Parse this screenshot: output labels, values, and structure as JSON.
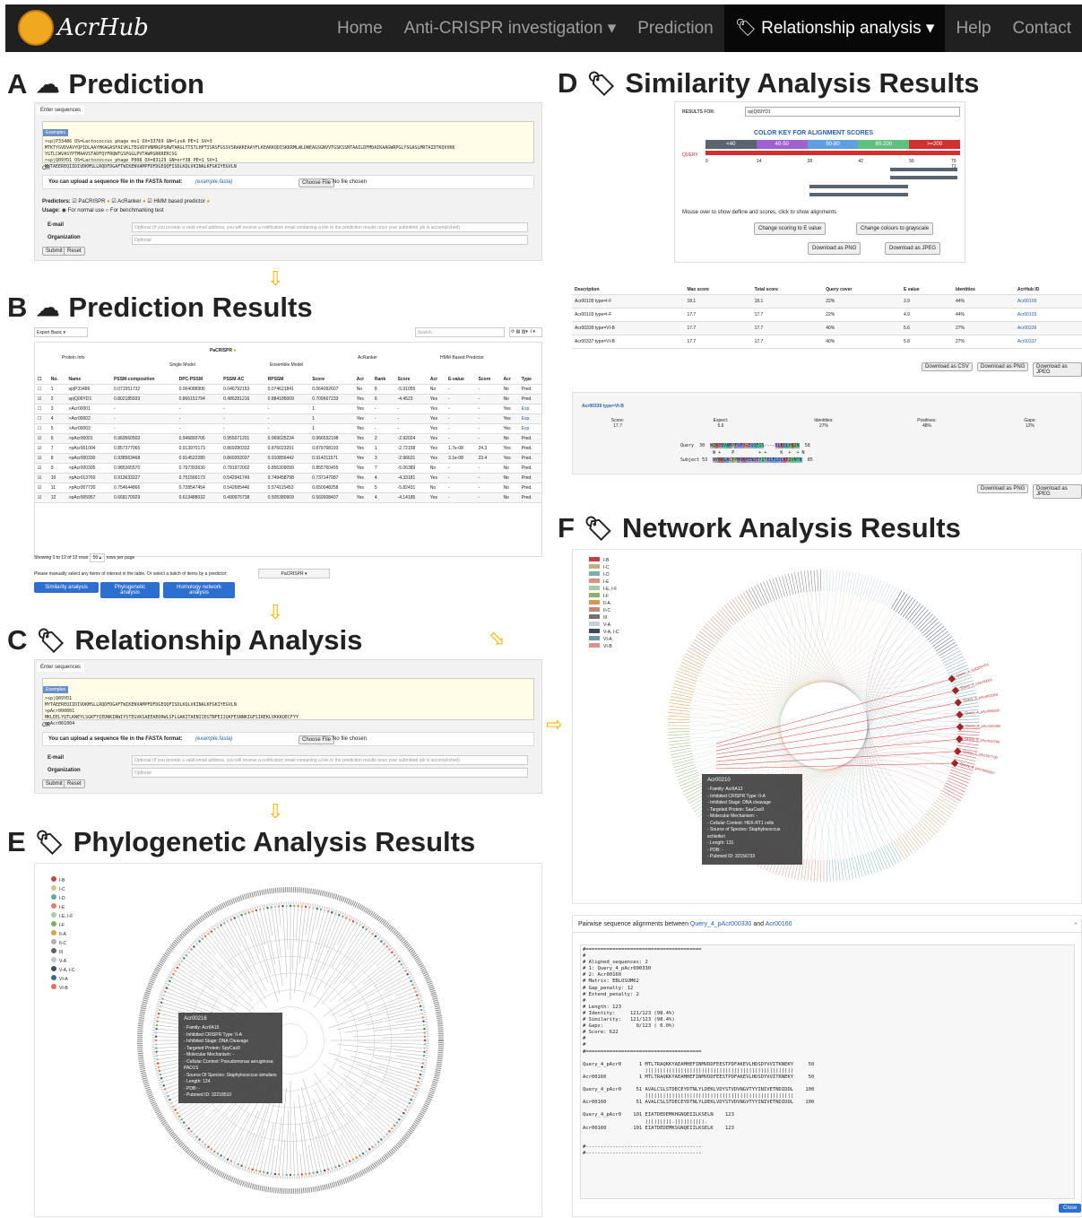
{
  "nav": {
    "logo": "AcrHub",
    "items": [
      "Home",
      "Anti-CRISPR investigation ▾",
      "Prediction",
      "🏷 Relationship analysis ▾",
      "Help",
      "Contact"
    ]
  },
  "sections": {
    "A": {
      "letter": "A",
      "icon": "☁",
      "title": "Prediction"
    },
    "B": {
      "letter": "B",
      "icon": "☁",
      "title": "Prediction Results"
    },
    "C": {
      "letter": "C",
      "icon": "🏷",
      "title": "Relationship Analysis"
    },
    "D": {
      "letter": "D",
      "icon": "🏷",
      "title": "Similarity Analysis Results"
    },
    "E": {
      "letter": "E",
      "icon": "🏷",
      "title": "Phylogenetic Analysis Results"
    },
    "F": {
      "letter": "F",
      "icon": "🏷",
      "title": "Network Analysis Results"
    }
  },
  "predform": {
    "tab": "Enter sequences",
    "example": "Examples",
    "seq": ">sp|P33486 OS=Lactococcus phage mv1 OX=33769 GN=lysA PE=1 SV=3\nMTKTYGVDVAVYQPIDLAAYHKAGASFAIVKLTEGVDYVNMRGPSRWTARGLTTSTLHPTISRSFGSSVSRAKKEAAYFLKEAKKQDISKKRMLWLDWEAGSGNVVTGSKSSNTAAILDFMDAIKAAGWRPGLYSGASLMRTAIDTKQVVKK\nYGTLCWVASYPTMAAVSTADFQYFRQWTGSPGGLPVTAWPGRRRERCSG\n>sp|Q09YD1 OS=Lactococcus phage P008 OX=83129 GN=orf38 PE=1 SV=1\nMYTAEEREQIIDIVDKMSLLRQDFDGAFTWIKENVAMPFDFDGEQQFISDLKQLVKINALKFGKIYEGVLN",
    "or": "OR",
    "upload": "You can upload a sequence file in the FASTA format:",
    "upload_link": "(example.fasta)",
    "choose": "Choose File",
    "nofile": "No file chosen",
    "predictors_label": "Predictors:",
    "predictors": [
      "PaCRISPR",
      "AcRanker",
      "HMM based predictor"
    ],
    "usage_label": "Usage:",
    "usage": [
      "For normal use",
      "For benchmarking test"
    ],
    "email_label": "E-mail",
    "email_ph": "Optional (If you provide a valid email address, you will receive a notification email containing a link to the prediction results once your submitted job is accomplished)",
    "org_label": "Organization",
    "org_ph": "Optional",
    "submit": "Submit",
    "reset": "Reset"
  },
  "results": {
    "export": "Export Basic",
    "search": "Search",
    "group_pacrispr": "PaCRISPR",
    "group_single": "Single Model",
    "group_ensemble": "Ensemble Model",
    "group_acranker": "AcRanker",
    "group_hmm": "HMM Based Predictor",
    "headers": [
      "No.",
      "Name",
      "PSSM-composition",
      "DPC-PSSM",
      "PSSM-AC",
      "RPSSM",
      "Score",
      "Acr",
      "Rank",
      "Score",
      "Acr",
      "E-value",
      "Score",
      "Acr",
      "Type"
    ],
    "protein_info": "Protein Info",
    "rows": [
      [
        "1",
        "sp|P33486",
        "0.071551732",
        "0.064088906",
        "0.046792153",
        "0.074621841",
        "0.064092607",
        "No",
        "8",
        "-5.91055",
        "No",
        "-",
        "-",
        "No",
        "Pred."
      ],
      [
        "2",
        "sp|Q09YD1",
        "0.802185933",
        "0.866151794",
        "0.486281216",
        "0.884185009",
        "0.709667233",
        "Yes",
        "6",
        "-4.4523",
        "Yes",
        "-",
        "-",
        "No",
        "Pred."
      ],
      [
        "3",
        "&gt;Acr00001",
        "-",
        "-",
        "-",
        "-",
        "1",
        "Yes",
        "-",
        "-",
        "Yes",
        "-",
        "-",
        "Yes",
        "Exp."
      ],
      [
        "4",
        "&gt;Acr00002",
        "-",
        "-",
        "-",
        "-",
        "1",
        "Yes",
        "-",
        "-",
        "Yes",
        "-",
        "-",
        "Yes",
        "Exp."
      ],
      [
        "5",
        "&gt;Acr00003",
        "-",
        "-",
        "-",
        "-",
        "1",
        "Yes",
        "-",
        "-",
        "Yes",
        "-",
        "-",
        "Yes",
        "Exp."
      ],
      [
        "6",
        "&gt;pAcr00001",
        "0.960560503",
        "0.946893706",
        "0.955071201",
        "0.969025234",
        "0.966532198",
        "Yes",
        "2",
        "-2.92024",
        "Yes",
        "-",
        "-",
        "No",
        "Pred."
      ],
      [
        "7",
        "&gt;pAcr001004",
        "0.857377065",
        "0.913970173",
        "0.869280332",
        "0.876023291",
        "0.879768193",
        "Yes",
        "1",
        "-2.72158",
        "Yes",
        "1.7e-08",
        "24.3",
        "Yes",
        "Pred."
      ],
      [
        "8",
        "&gt;pAcr000330",
        "0.938563468",
        "0.914522280",
        "0.869392037",
        "0.910856442",
        "0.914211571",
        "Yes",
        "3",
        "-2.96631",
        "Yes",
        "3.1e-08",
        "23.4",
        "Yes",
        "Pred."
      ],
      [
        "9",
        "&gt;pAcr000395",
        "0.985365570",
        "0.797393630",
        "0.781972002",
        "0.856309099",
        "0.855760455",
        "Yes",
        "7",
        "-5.06389",
        "No",
        "-",
        "-",
        "No",
        "Pred."
      ],
      [
        "10",
        "&gt;pAcr013760",
        "0.913633227",
        "0.751566173",
        "0.542941749",
        "0.749458798",
        "0.737147987",
        "Yes",
        "4",
        "-4.33181",
        "Yes",
        "-",
        "-",
        "No",
        "Pred."
      ],
      [
        "11",
        "&gt;pAcr007730",
        "0.754644866",
        "0.728547454",
        "0.542685446",
        "0.574115453",
        "0.650048258",
        "Yes",
        "5",
        "-5.82431",
        "No",
        "-",
        "-",
        "No",
        "Pred."
      ],
      [
        "12",
        "&gt;pAcr005957",
        "0.668170929",
        "0.613488032",
        "0.490975738",
        "0.505380909",
        "0.569508407",
        "Yes",
        "4",
        "-4.14185",
        "Yes",
        "-",
        "-",
        "No",
        "Pred."
      ]
    ],
    "showing": "Showing 1 to 12 of 12 rows",
    "per_page": "50 ▴",
    "rows_per_page": "rows per page",
    "manual": "Please manually select any items of interest in the table. Or select a batch of items by a predictor:",
    "predictor_sel": "PaCRISPR ▾",
    "buttons": [
      "Similarity analysis",
      "Phylogenetic analysis",
      "Homology network analysis"
    ]
  },
  "relform": {
    "tab": "Enter sequences",
    "example": "Examples",
    "seq": ">sp|Q09YD1\nMYTAEEREQIIDIVDKMSLLRQDFDGAFTWIKENVAMPFDFDGEQQFISDLKQLVKINALKFGKIYEGVLN\n>pAcr000001\nMKLEELYQTLKNEYLSGKFYIEDNKINWIYSTEGVKSAEEAEDRWLSFLGAKITAENIIEGTNFEIIQKFESNNKIGFSIREKLVKKKQECFYY\n>pAcr001004",
    "or": "OR",
    "upload": "You can upload a sequence file in the FASTA format:",
    "upload_link": "(example.fasta)",
    "choose": "Choose File",
    "nofile": "No file chosen",
    "email_label": "E-mail",
    "email_ph": "Optional (If you provide a valid email address, you will receive a notification email containing a link to the prediction results once your submitted job is accomplished)",
    "org_label": "Organization",
    "org_ph": "Optional",
    "submit": "Submit",
    "reset": "Reset"
  },
  "similarity": {
    "results_for": "RESULTS FOR:",
    "selected": "sp|Q09YD1",
    "key_title": "COLOR KEY FOR ALIGNMENT SCORES",
    "key": [
      {
        "label": "<40",
        "color": "#5a6470"
      },
      {
        "label": "40-50",
        "color": "#a060d0"
      },
      {
        "label": "50-80",
        "color": "#60a0e0"
      },
      {
        "label": "80-200",
        "color": "#60c080"
      },
      {
        "label": ">=200",
        "color": "#d03030"
      }
    ],
    "query": "QUERY",
    "ticks": [
      "0",
      "14",
      "28",
      "42",
      "56",
      "70 71"
    ],
    "hint": "Mouse over to show defline and scores, click to show alignments",
    "btns": [
      "Change scoring to E value",
      "Change colours to grayscale",
      "Download as PNG",
      "Download as JPEG"
    ],
    "table_headers": [
      "Description",
      "Max score",
      "Total score",
      "Query cover",
      "E value",
      "Identities",
      "AcrHub ID"
    ],
    "table_rows": [
      [
        "Acr00109 type=I-F",
        "18.1",
        "18.1",
        "22%",
        "3.9",
        "44%",
        "Acr00109"
      ],
      [
        "Acr00103 type=I-F",
        "17.7",
        "17.7",
        "22%",
        "4.9",
        "44%",
        "Acr00103"
      ],
      [
        "Acr00339 type=VI-B",
        "17.7",
        "17.7",
        "40%",
        "5.6",
        "27%",
        "Acr00339"
      ],
      [
        "Acr00337 type=VI-B",
        "17.7",
        "17.7",
        "40%",
        "5.8",
        "27%",
        "Acr00337"
      ]
    ],
    "table_btns": [
      "Download as CSV",
      "Download as PNG",
      "Download as JPEG"
    ],
    "align_title": "Acr00339 type=VI-B",
    "align_stats": [
      {
        "k": "Score:",
        "v": "17.7"
      },
      {
        "k": "Expect:",
        "v": "5.6"
      },
      {
        "k": "Identities:",
        "v": "27%"
      },
      {
        "k": "Positives:",
        "v": "48%"
      },
      {
        "k": "Gaps:",
        "v": "12%"
      }
    ],
    "q_label": "Query",
    "q_start": "30",
    "q_seq": "WIKENVAMPFDFDGEQQFIS----DLKQLVKIN",
    "q_end": "58",
    "m_seq": "W +    P         + +     K  +  + N",
    "s_label": "Subject",
    "s_start": "53",
    "s_seq": "WYKKLACTPMDKMENDEYITELFLDLKEIVNTN",
    "s_end": "85",
    "align_btns": [
      "Download as PNG",
      "Download as JPEG"
    ]
  },
  "phylo": {
    "legend": [
      {
        "label": "I-B",
        "color": "#d04040"
      },
      {
        "label": "I-C",
        "color": "#c8c890"
      },
      {
        "label": "I-D",
        "color": "#60a8a8"
      },
      {
        "label": "I-E",
        "color": "#e08070"
      },
      {
        "label": "I-E, I-F",
        "color": "#a8d0a8"
      },
      {
        "label": "I-F",
        "color": "#80b060"
      },
      {
        "label": "II-A",
        "color": "#e0a040"
      },
      {
        "label": "II-C",
        "color": "#b0b0b0"
      },
      {
        "label": "III",
        "color": "#606060"
      },
      {
        "label": "V-A",
        "color": "#c0c8d0"
      },
      {
        "label": "V-A, I-C",
        "color": "#404870"
      },
      {
        "label": "VI-A",
        "color": "#406880"
      },
      {
        "label": "VI-B",
        "color": "#e07060"
      }
    ],
    "tip_title": "Acr00216",
    "tip_lines": [
      "- Family: AcrIIA15",
      "- Inhibited CRISPR Type: II-A",
      "- Inhibited Stage: DNA Cleavage",
      "- Targeted Protein: SpyCas9",
      "- Molecular Mechanism: -",
      "- Cellular Context: Pseudomonas aeruginosa PAO1S",
      "- Source Of Species: Staphylococcus simulans",
      "- Length: 124",
      "- PDB: -",
      "- Pubmed ID: 32218510"
    ]
  },
  "network": {
    "legend": [
      {
        "label": "I-B",
        "color": "#c04040"
      },
      {
        "label": "I-C",
        "color": "#c0b080"
      },
      {
        "label": "I-D",
        "color": "#7ab0b0"
      },
      {
        "label": "I-E",
        "color": "#e09080"
      },
      {
        "label": "I-E, I-F",
        "color": "#a8c8a8"
      },
      {
        "label": "I-F",
        "color": "#90b070"
      },
      {
        "label": "II-A",
        "color": "#d09850"
      },
      {
        "label": "II-C",
        "color": "#c08878"
      },
      {
        "label": "III",
        "color": "#707070"
      },
      {
        "label": "V-A",
        "color": "#c8d0d8"
      },
      {
        "label": "V-A, I-C",
        "color": "#3a4a60"
      },
      {
        "label": "VI-A",
        "color": "#6a9aa8"
      },
      {
        "label": "VI-B",
        "color": "#e09088"
      }
    ],
    "queries": [
      "Query_1_sp|Q09YD1",
      "Query_2_pAcr00001",
      "Query_3_pAcr001004",
      "Query_4_pAcr000330",
      "Query_5_pAcr000395",
      "Query_6_pAcr013760",
      "Query_7_pAcr007730",
      "Query_8_pAcr005957"
    ],
    "tip_title": "Acr00210",
    "tip_lines": [
      "- Family: AcrIIA13",
      "- Inhibited CRISPR Type: II-A",
      "- Inhibited Stage: DNA cleavage",
      "- Targeted Protein: SauCas9",
      "- Molecular Mechanism: -",
      "- Cellular Context: HEK-RT1 cells",
      "- Source of Species: Staphylococcus schleiferi",
      "- Length: 131",
      "- PDB: -",
      "- Pubmed ID: 32156733"
    ]
  },
  "pairwise": {
    "title_pre": "Pairwise sequence alignments between ",
    "q": "Query_4_pAcr000330",
    "and": " and ",
    "s": "Acr00160",
    "text": "#=======================================\n#\n# Aligned_sequences: 2\n# 1: Query_4_pAcr000330\n# 2: Acr00160\n# Matrix: EBLOSUM62\n# Gap_penalty: 12\n# Extend_penalty: 2\n#\n# Length: 123\n# Identity:     121/123 (98.4%)\n# Similarity:   121/123 (98.4%)\n# Gaps:           0/123 ( 0.0%)\n# Score: 622\n#\n#\n#=======================================\n\nQuery_4_pAcr0      1 MTLTRAQKKYAEAMHEFINMVDDFEESTPDFAKEVLHDSDYVVITKNEKY     50\n                     ||||||||||||||||||||||||||||||||||||||||||||||||||\nAcr00160           1 MTLTRAQKKYAEAMHEFINMVDDFEESTPDFAKEVLHDSDYVVITKNEKY     50\n\nQuery_4_pAcr0     51 AVALCSLSTDECEYDTNLYLDEKLVDYSTVDVNGVTYYINIVETNDIDDL    100\n                     ||||||||||||||||||||||||||||||||||||||||||||||||||\nAcr00160          51 AVALCSLSTDECEYDTNLYLDEKLVDYSTVDVNGVTYYINIVETNDIDDL    100\n\nQuery_4_pAcr0    101 EIATDEDEMKHGNQEIILKSELN    123\n                     |||||||||.||||||||||.\nAcr00160         101 EIATDEDEMKSGNQEIILKSELK    123\n\n\n#---------------------------------------\n#---------------------------------------",
    "close": "Close"
  }
}
